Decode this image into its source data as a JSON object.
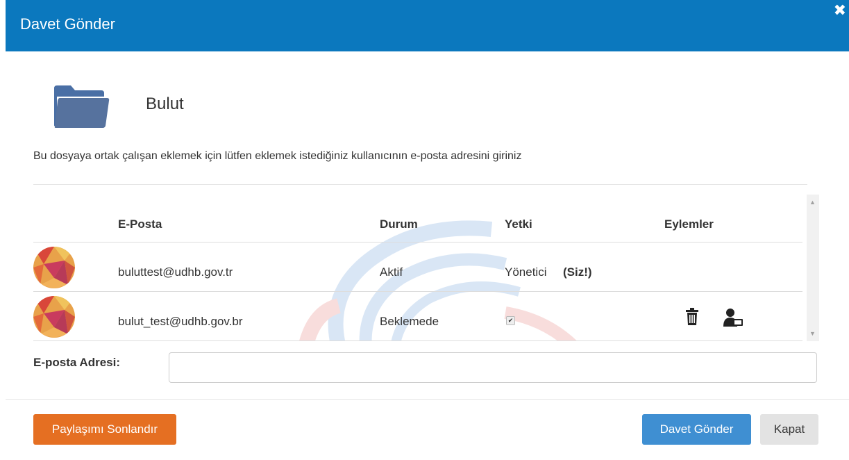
{
  "dialog": {
    "title": "Davet Gönder",
    "close_glyph": "✖",
    "folder_name": "Bulut",
    "description": "Bu dosyaya ortak çalışan eklemek için lütfen eklemek istediğiniz kullanıcının e-posta adresini giriniz"
  },
  "table": {
    "headers": {
      "email": "E-Posta",
      "status": "Durum",
      "permission": "Yetki",
      "actions": "Eylemler"
    },
    "rows": [
      {
        "email": "buluttest@udhb.gov.tr",
        "status": "Aktif",
        "permission": "Yönetici",
        "badge": "(Siz!)"
      },
      {
        "email": "bulut_test@udhb.gov.br",
        "status": "Beklemede",
        "checkbox_checked": true,
        "checkbox_glyph": "✔"
      }
    ]
  },
  "form": {
    "email_label": "E-posta Adresi:",
    "email_value": "",
    "email_placeholder": ""
  },
  "buttons": {
    "end_share": "Paylaşımı Sonlandır",
    "send_invite": "Davet Gönder",
    "close": "Kapat"
  },
  "colors": {
    "header": "#0b78be",
    "folder_icon": "#4a6fa5",
    "end_share_button": "#e56f22",
    "send_invite_button": "#3f8fd2",
    "close_button": "#e3e3e3"
  },
  "icons": {
    "folder": "folder-icon",
    "close": "close-icon",
    "delete": "trash-icon",
    "assign": "user-monitor-icon"
  }
}
